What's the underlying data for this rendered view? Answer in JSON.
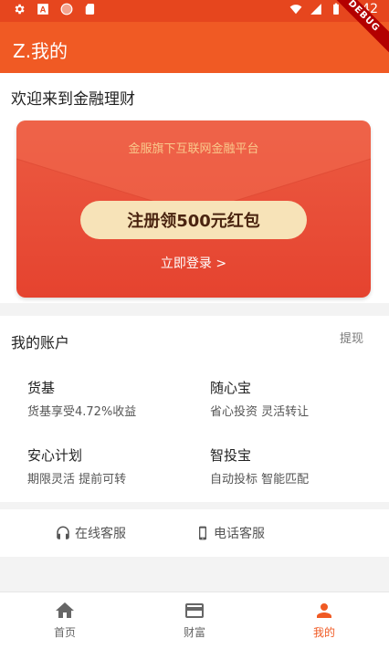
{
  "status_bar": {
    "time": "9:42",
    "icons": [
      "gear-icon",
      "a-icon",
      "circle-icon",
      "sd-card-icon",
      "wifi-icon",
      "signal-icon",
      "battery-icon"
    ]
  },
  "debug_banner": "DEBUG",
  "app_bar": {
    "title": "Z.我的"
  },
  "welcome": {
    "text": "欢迎来到金融理财"
  },
  "envelope": {
    "subtitle": "金服旗下互联网金融平台",
    "button_label": "注册领500元红包",
    "login_link": "立即登录 >"
  },
  "account": {
    "title": "我的账户",
    "withdraw_label": "提现",
    "products": [
      {
        "name": "货基",
        "desc": "货基享受4.72%收益"
      },
      {
        "name": "随心宝",
        "desc": "省心投资 灵活转让"
      },
      {
        "name": "安心计划",
        "desc": "期限灵活 提前可转"
      },
      {
        "name": "智投宝",
        "desc": "自动投标 智能匹配"
      }
    ]
  },
  "services": {
    "online": "在线客服",
    "phone": "电话客服"
  },
  "bottom_nav": {
    "items": [
      {
        "label": "首页",
        "icon": "home-icon"
      },
      {
        "label": "财富",
        "icon": "card-icon"
      },
      {
        "label": "我的",
        "icon": "person-icon"
      }
    ],
    "active": "我的"
  },
  "colors": {
    "accent": "#f05a24",
    "status_bar": "#e6461e",
    "envelope_red": "#e5432f",
    "envelope_button": "#f7e3b8",
    "envelope_subtitle": "#f9c98c"
  }
}
